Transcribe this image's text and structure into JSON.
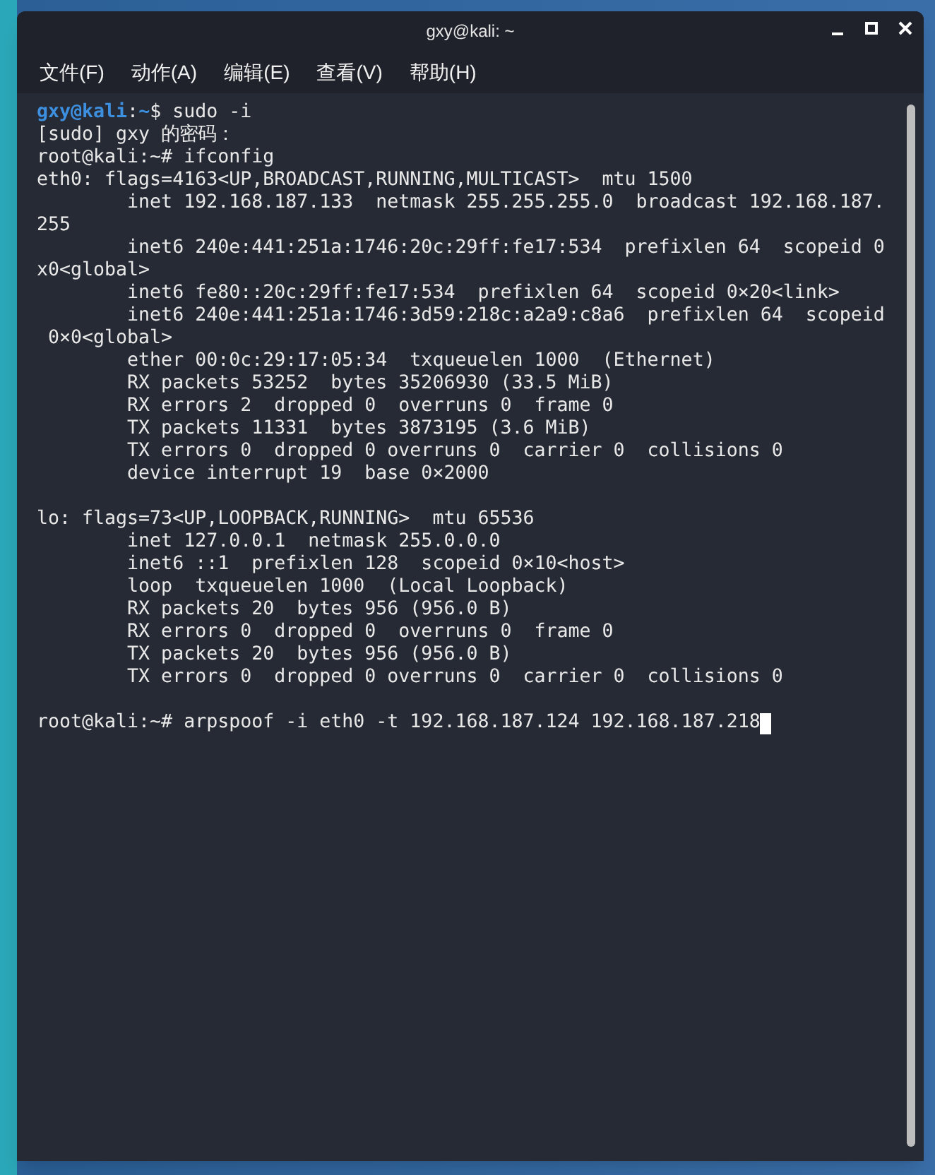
{
  "window": {
    "title": "gxy@kali: ~"
  },
  "menu": [
    "文件(F)",
    "动作(A)",
    "编辑(E)",
    "查看(V)",
    "帮助(H)"
  ],
  "terminal": {
    "cursor": true,
    "blocks": [
      {
        "lines": [
          {
            "segments": [
              {
                "text": "gxy@kali",
                "kind": "user"
              },
              {
                "text": ":",
                "kind": "plain"
              },
              {
                "text": "~",
                "kind": "path"
              },
              {
                "text": "$ sudo -i",
                "kind": "plain"
              }
            ]
          },
          {
            "segments": [
              {
                "text": "[sudo] gxy 的密码：",
                "kind": "plain"
              }
            ]
          },
          {
            "segments": [
              {
                "text": "root@kali:~# ifconfig",
                "kind": "plain"
              }
            ]
          },
          {
            "segments": [
              {
                "text": "eth0: flags=4163<UP,BROADCAST,RUNNING,MULTICAST>  mtu 1500",
                "kind": "plain"
              }
            ]
          },
          {
            "segments": [
              {
                "text": "        inet 192.168.187.133  netmask 255.255.255.0  broadcast 192.168.187.",
                "kind": "plain"
              }
            ]
          },
          {
            "segments": [
              {
                "text": "255",
                "kind": "plain"
              }
            ]
          },
          {
            "segments": [
              {
                "text": "        inet6 240e:441:251a:1746:20c:29ff:fe17:534  prefixlen 64  scopeid 0",
                "kind": "plain"
              }
            ]
          },
          {
            "segments": [
              {
                "text": "x0<global>",
                "kind": "plain"
              }
            ]
          },
          {
            "segments": [
              {
                "text": "        inet6 fe80::20c:29ff:fe17:534  prefixlen 64  scopeid 0×20<link>",
                "kind": "plain"
              }
            ]
          },
          {
            "segments": [
              {
                "text": "        inet6 240e:441:251a:1746:3d59:218c:a2a9:c8a6  prefixlen 64  scopeid",
                "kind": "plain"
              }
            ]
          },
          {
            "segments": [
              {
                "text": " 0×0<global>",
                "kind": "plain"
              }
            ]
          },
          {
            "segments": [
              {
                "text": "        ether 00:0c:29:17:05:34  txqueuelen 1000  (Ethernet)",
                "kind": "plain"
              }
            ]
          },
          {
            "segments": [
              {
                "text": "        RX packets 53252  bytes 35206930 (33.5 MiB)",
                "kind": "plain"
              }
            ]
          },
          {
            "segments": [
              {
                "text": "        RX errors 2  dropped 0  overruns 0  frame 0",
                "kind": "plain"
              }
            ]
          },
          {
            "segments": [
              {
                "text": "        TX packets 11331  bytes 3873195 (3.6 MiB)",
                "kind": "plain"
              }
            ]
          },
          {
            "segments": [
              {
                "text": "        TX errors 0  dropped 0 overruns 0  carrier 0  collisions 0",
                "kind": "plain"
              }
            ]
          },
          {
            "segments": [
              {
                "text": "        device interrupt 19  base 0×2000",
                "kind": "plain"
              }
            ]
          }
        ]
      },
      {
        "lines": [
          {
            "segments": [
              {
                "text": "lo: flags=73<UP,LOOPBACK,RUNNING>  mtu 65536",
                "kind": "plain"
              }
            ]
          },
          {
            "segments": [
              {
                "text": "        inet 127.0.0.1  netmask 255.0.0.0",
                "kind": "plain"
              }
            ]
          },
          {
            "segments": [
              {
                "text": "        inet6 ::1  prefixlen 128  scopeid 0×10<host>",
                "kind": "plain"
              }
            ]
          },
          {
            "segments": [
              {
                "text": "        loop  txqueuelen 1000  (Local Loopback)",
                "kind": "plain"
              }
            ]
          },
          {
            "segments": [
              {
                "text": "        RX packets 20  bytes 956 (956.0 B)",
                "kind": "plain"
              }
            ]
          },
          {
            "segments": [
              {
                "text": "        RX errors 0  dropped 0  overruns 0  frame 0",
                "kind": "plain"
              }
            ]
          },
          {
            "segments": [
              {
                "text": "        TX packets 20  bytes 956 (956.0 B)",
                "kind": "plain"
              }
            ]
          },
          {
            "segments": [
              {
                "text": "        TX errors 0  dropped 0 overruns 0  carrier 0  collisions 0",
                "kind": "plain"
              }
            ]
          }
        ]
      },
      {
        "lines": [
          {
            "segments": [
              {
                "text": "root@kali:~# arpspoof -i eth0 -t 192.168.187.124 192.168.187.218",
                "kind": "plain"
              }
            ]
          }
        ]
      }
    ]
  }
}
